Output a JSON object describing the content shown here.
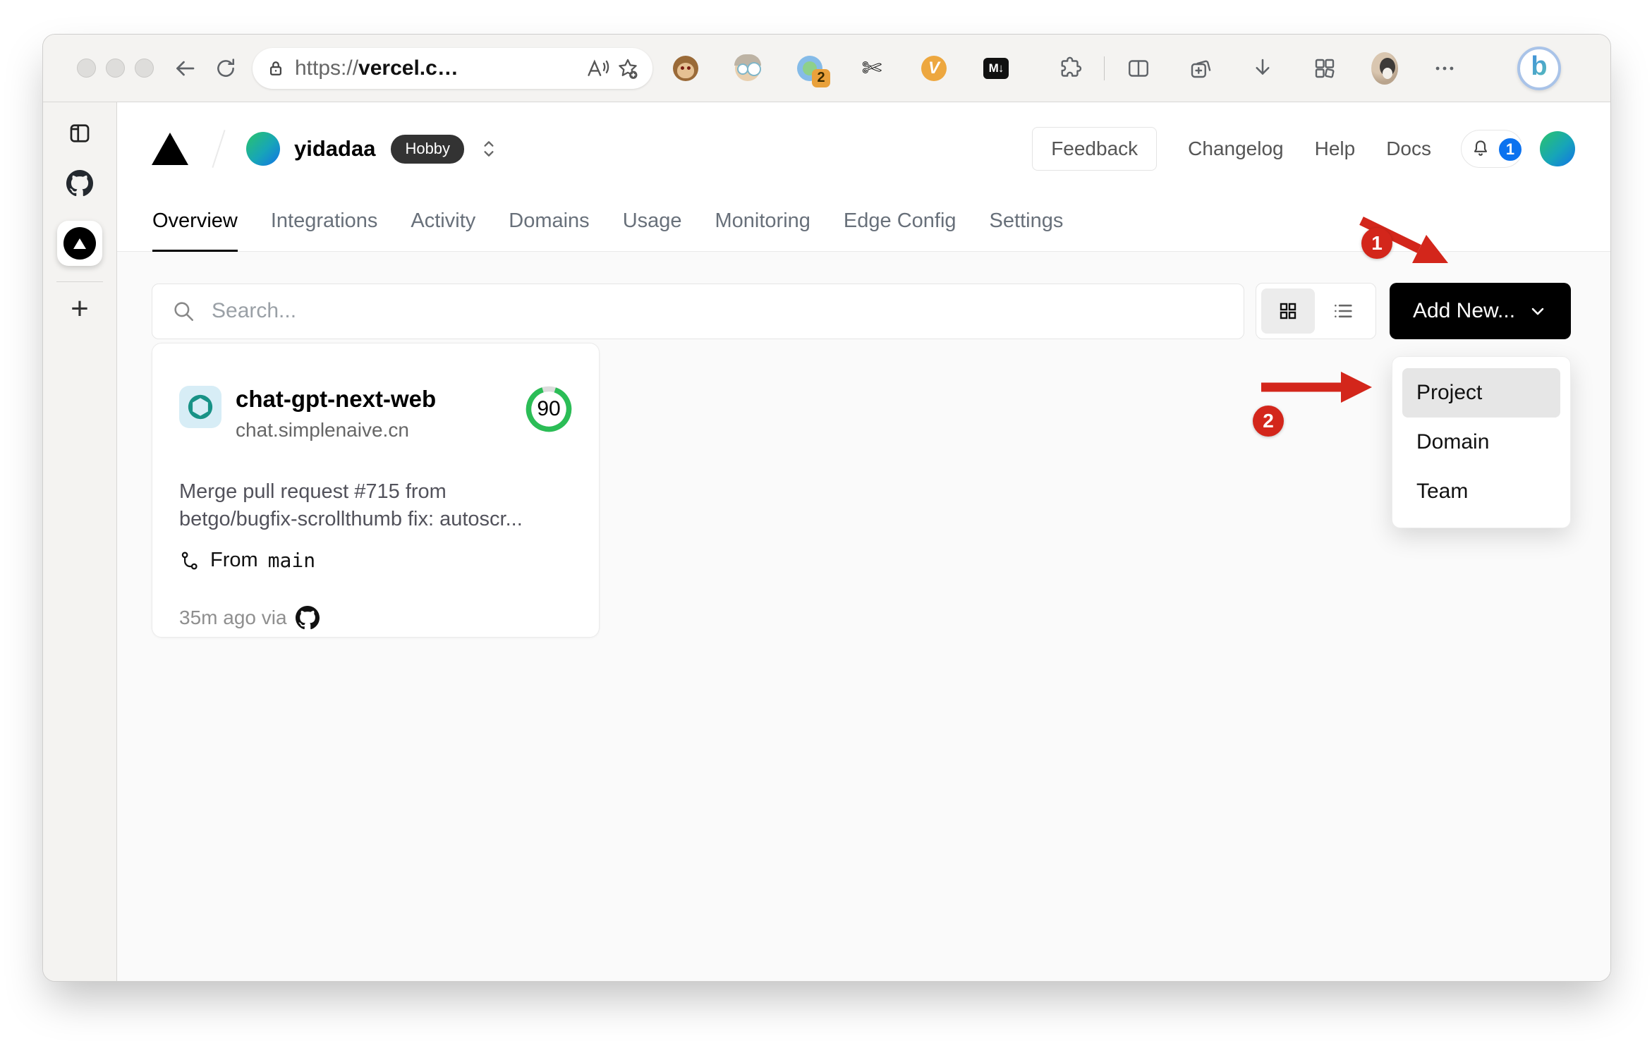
{
  "browser": {
    "url": {
      "prefix": "https://",
      "domain": "vercel.c…"
    },
    "extensions": {
      "session_badge": "2",
      "v_letter": "V",
      "markdown_label": "M↓"
    },
    "bing_letter": "b"
  },
  "vercel": {
    "team": {
      "name": "yidadaa",
      "plan": "Hobby"
    },
    "nav": {
      "feedback": "Feedback",
      "changelog": "Changelog",
      "help": "Help",
      "docs": "Docs",
      "notification_count": "1"
    },
    "tabs": [
      {
        "label": "Overview",
        "active": true
      },
      {
        "label": "Integrations"
      },
      {
        "label": "Activity"
      },
      {
        "label": "Domains"
      },
      {
        "label": "Usage"
      },
      {
        "label": "Monitoring"
      },
      {
        "label": "Edge Config"
      },
      {
        "label": "Settings"
      }
    ],
    "toolbar": {
      "search_placeholder": "Search...",
      "add_new_label": "Add New..."
    },
    "project": {
      "name": "chat-gpt-next-web",
      "domain": "chat.simplenaive.cn",
      "score": "90",
      "commit_line1": "Merge pull request #715 from",
      "commit_line2": "betgo/bugfix-scrollthumb fix: autoscr...",
      "branch_label": "From",
      "branch_name": "main",
      "deploy_meta": "35m ago via"
    },
    "dropdown": {
      "items": [
        {
          "label": "Project",
          "highlighted": true
        },
        {
          "label": "Domain"
        },
        {
          "label": "Team"
        }
      ]
    }
  },
  "annotations": {
    "step1": "1",
    "step2": "2"
  },
  "colors": {
    "annotation_red": "#d3261b",
    "score_green": "#2bbd56",
    "badge_blue": "#0b72ef",
    "brand_black": "#000000",
    "body_bg": "#fafafa"
  }
}
